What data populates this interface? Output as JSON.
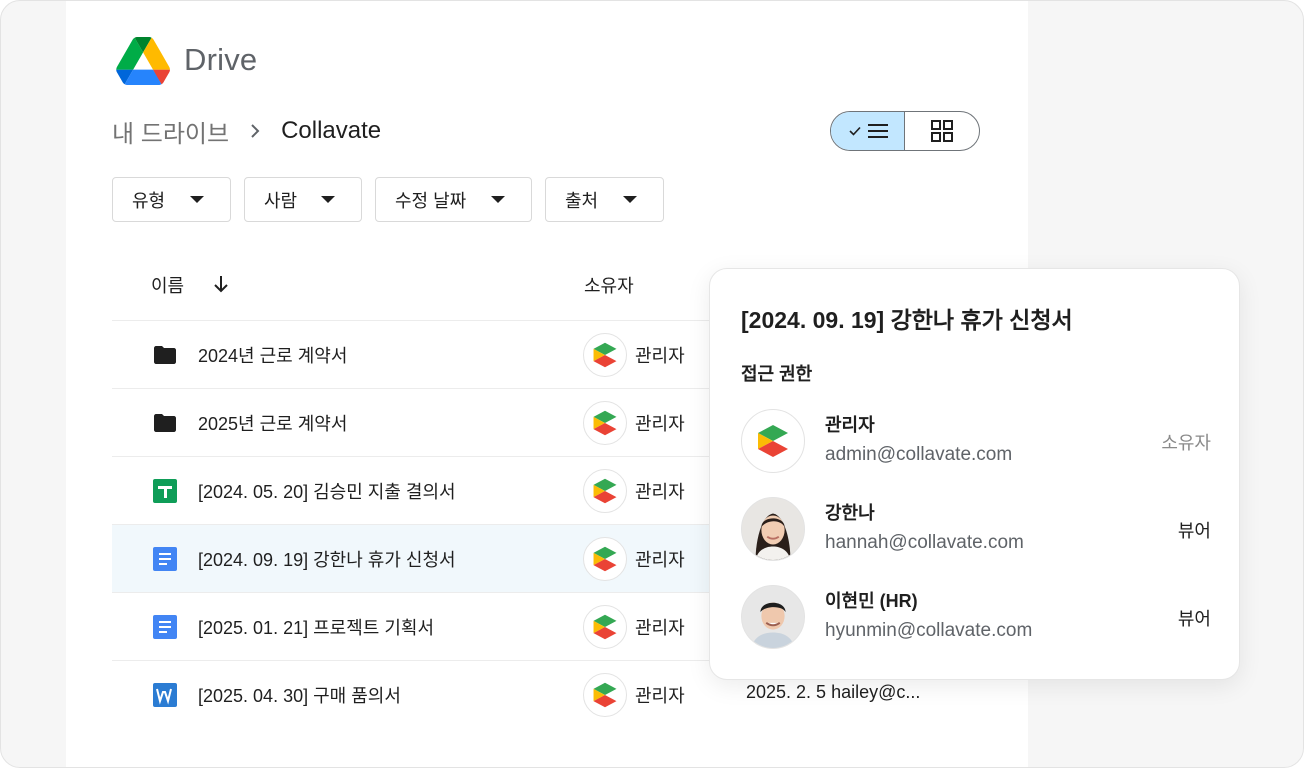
{
  "app": {
    "name": "Drive"
  },
  "breadcrumb": {
    "parent": "내 드라이브",
    "current": "Collavate"
  },
  "view_toggle": {
    "active": "list"
  },
  "filters": [
    "유형",
    "사람",
    "수정 날짜",
    "출처"
  ],
  "table": {
    "columns": {
      "name": "이름",
      "owner": "소유자"
    },
    "rows": [
      {
        "icon": "folder-icon",
        "name": "2024년 근로 계약서",
        "owner": "관리자",
        "modified": ""
      },
      {
        "icon": "folder-icon",
        "name": "2025년 근로 계약서",
        "owner": "관리자",
        "modified": ""
      },
      {
        "icon": "sheets-icon",
        "name": "[2024. 05. 20] 김승민 지출 결의서",
        "owner": "관리자",
        "modified": ""
      },
      {
        "icon": "docs-icon",
        "name": "[2024. 09. 19] 강한나 휴가 신청서",
        "owner": "관리자",
        "modified": ""
      },
      {
        "icon": "docs-icon",
        "name": "[2025. 01. 21] 프로젝트 기획서",
        "owner": "관리자",
        "modified": ""
      },
      {
        "icon": "word-icon",
        "name": "[2025. 04. 30] 구매 품의서",
        "owner": "관리자",
        "modified": "2025. 2. 5  hailey@c..."
      }
    ]
  },
  "popup": {
    "title": "[2024. 09. 19] 강한나 휴가 신청서",
    "subtitle": "접근 권한",
    "people": [
      {
        "name": "관리자",
        "email": "admin@collavate.com",
        "role": "소유자",
        "avatar": "collavate-logo"
      },
      {
        "name": "강한나",
        "email": "hannah@collavate.com",
        "role": "뷰어",
        "avatar": "photo-woman"
      },
      {
        "name": "이현민 (HR)",
        "email": "hyunmin@collavate.com",
        "role": "뷰어",
        "avatar": "photo-man"
      }
    ]
  },
  "colors": {
    "accent_toggle": "#c2e7ff",
    "selected_row": "#f1f8fc",
    "sheets_green": "#0f9d58",
    "docs_blue": "#4285f4",
    "word_blue": "#2b7cd3"
  }
}
